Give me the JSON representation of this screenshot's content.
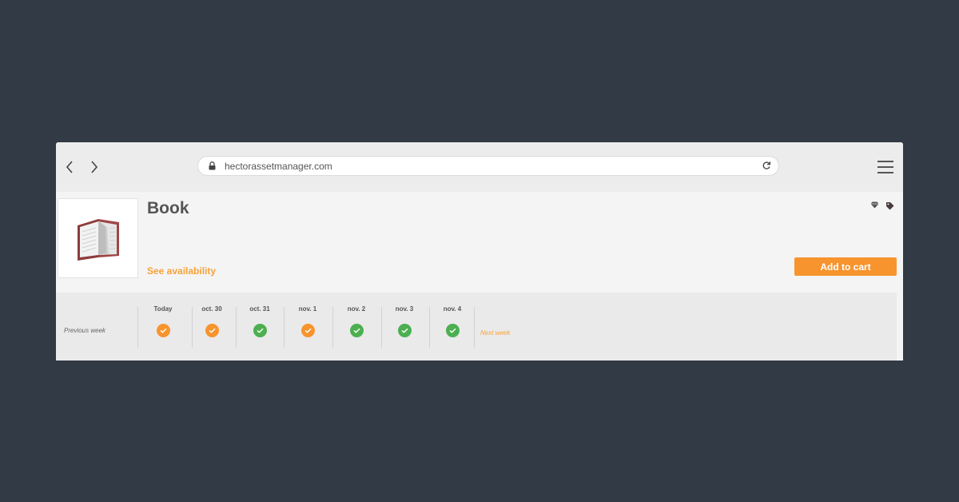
{
  "browser": {
    "url": "hectorassetmanager.com"
  },
  "product": {
    "title": "Book",
    "see_availability": "See availability",
    "add_to_cart": "Add to cart"
  },
  "calendar": {
    "previous_week": "Previous week",
    "next_week": "Next week",
    "days": [
      {
        "label": "Today",
        "status": "partially-available"
      },
      {
        "label": "oct. 30",
        "status": "partially-available"
      },
      {
        "label": "oct. 31",
        "status": "available"
      },
      {
        "label": "nov. 1",
        "status": "partially-available"
      },
      {
        "label": "nov. 2",
        "status": "available"
      },
      {
        "label": "nov. 3",
        "status": "available"
      },
      {
        "label": "nov. 4",
        "status": "available"
      }
    ]
  },
  "colors": {
    "background": "#323a45",
    "accent_orange": "#f7942e",
    "available_green": "#4caf50",
    "partial_orange": "#f7942e"
  }
}
